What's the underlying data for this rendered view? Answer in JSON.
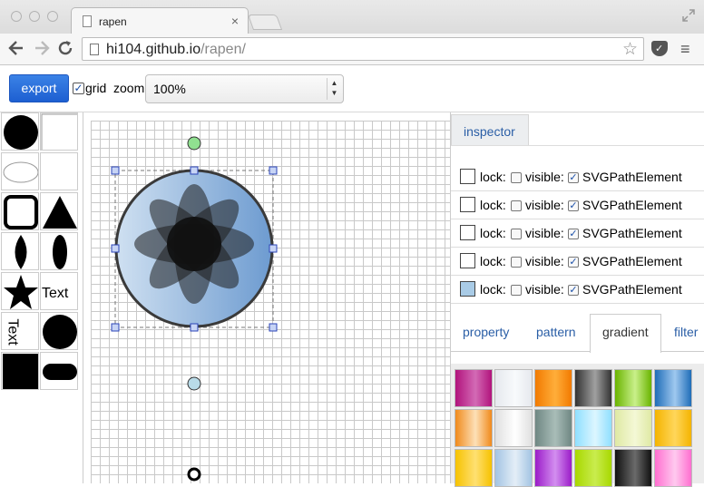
{
  "browser": {
    "tab_title": "rapen",
    "tab_close": "×",
    "url_host": "hi104.github.io",
    "url_path": "/rapen/",
    "back_icon": "back-arrow-icon",
    "forward_icon": "forward-arrow-icon",
    "reload_icon": "reload-icon",
    "star_glyph": "☆",
    "menu_glyph": "≡"
  },
  "toolbar": {
    "export_label": "export",
    "grid_label": "grid",
    "grid_checked": true,
    "zoom_label": "zoom:",
    "zoom_value": "100%"
  },
  "palette": {
    "text_label": "Text",
    "text_vertical_label": "Text",
    "shapes": [
      "circle-filled",
      "rectangle-outline",
      "ellipse-outline",
      "blank",
      "rounded-square-thick",
      "triangle",
      "lens-pointed",
      "ellipse-vertical",
      "star",
      "text",
      "text-vertical",
      "circle-filled",
      "square-filled",
      "pill"
    ]
  },
  "inspector": {
    "tab_label": "inspector",
    "lock_label": "lock:",
    "visible_label": "visible:",
    "rows": [
      {
        "type": "SVGPathElement",
        "color": "#ffffff",
        "lock": false,
        "visible": true
      },
      {
        "type": "SVGPathElement",
        "color": "#ffffff",
        "lock": false,
        "visible": true
      },
      {
        "type": "SVGPathElement",
        "color": "#ffffff",
        "lock": false,
        "visible": true
      },
      {
        "type": "SVGPathElement",
        "color": "#ffffff",
        "lock": false,
        "visible": true
      },
      {
        "type": "SVGPathElement",
        "color": "#a9cbe6",
        "lock": false,
        "visible": true
      }
    ],
    "subtabs": [
      "property",
      "pattern",
      "gradient",
      "filter"
    ],
    "active_subtab": "gradient"
  },
  "gradients": [
    [
      "#b1137c",
      "#d36ab5"
    ],
    [
      "#e6e9ee",
      "#f8fafc"
    ],
    [
      "#f27a00",
      "#ffae3a"
    ],
    [
      "#333333",
      "#a0a0a0"
    ],
    [
      "#6ab400",
      "#c9f08a"
    ],
    [
      "#1f6db8",
      "#9fc8ef"
    ],
    [
      "#f08a1c",
      "#fde0b7"
    ],
    [
      "#e0e0e0",
      "#ffffff"
    ],
    [
      "#6f8783",
      "#a9bdb8"
    ],
    [
      "#8fdfff",
      "#dcf6ff"
    ],
    [
      "#dfe9a4",
      "#f4f8d6"
    ],
    [
      "#f4b400",
      "#ffd65a"
    ],
    [
      "#f6c200",
      "#ffe071"
    ],
    [
      "#a3c4e3",
      "#e4eef7"
    ],
    [
      "#9b1cc8",
      "#d38ef0"
    ],
    [
      "#a8d800",
      "#c9ec4e"
    ],
    [
      "#111111",
      "#6a6a6a"
    ],
    [
      "#ff6fd0",
      "#ffc9ef"
    ]
  ],
  "accent": "#2a5ea6"
}
